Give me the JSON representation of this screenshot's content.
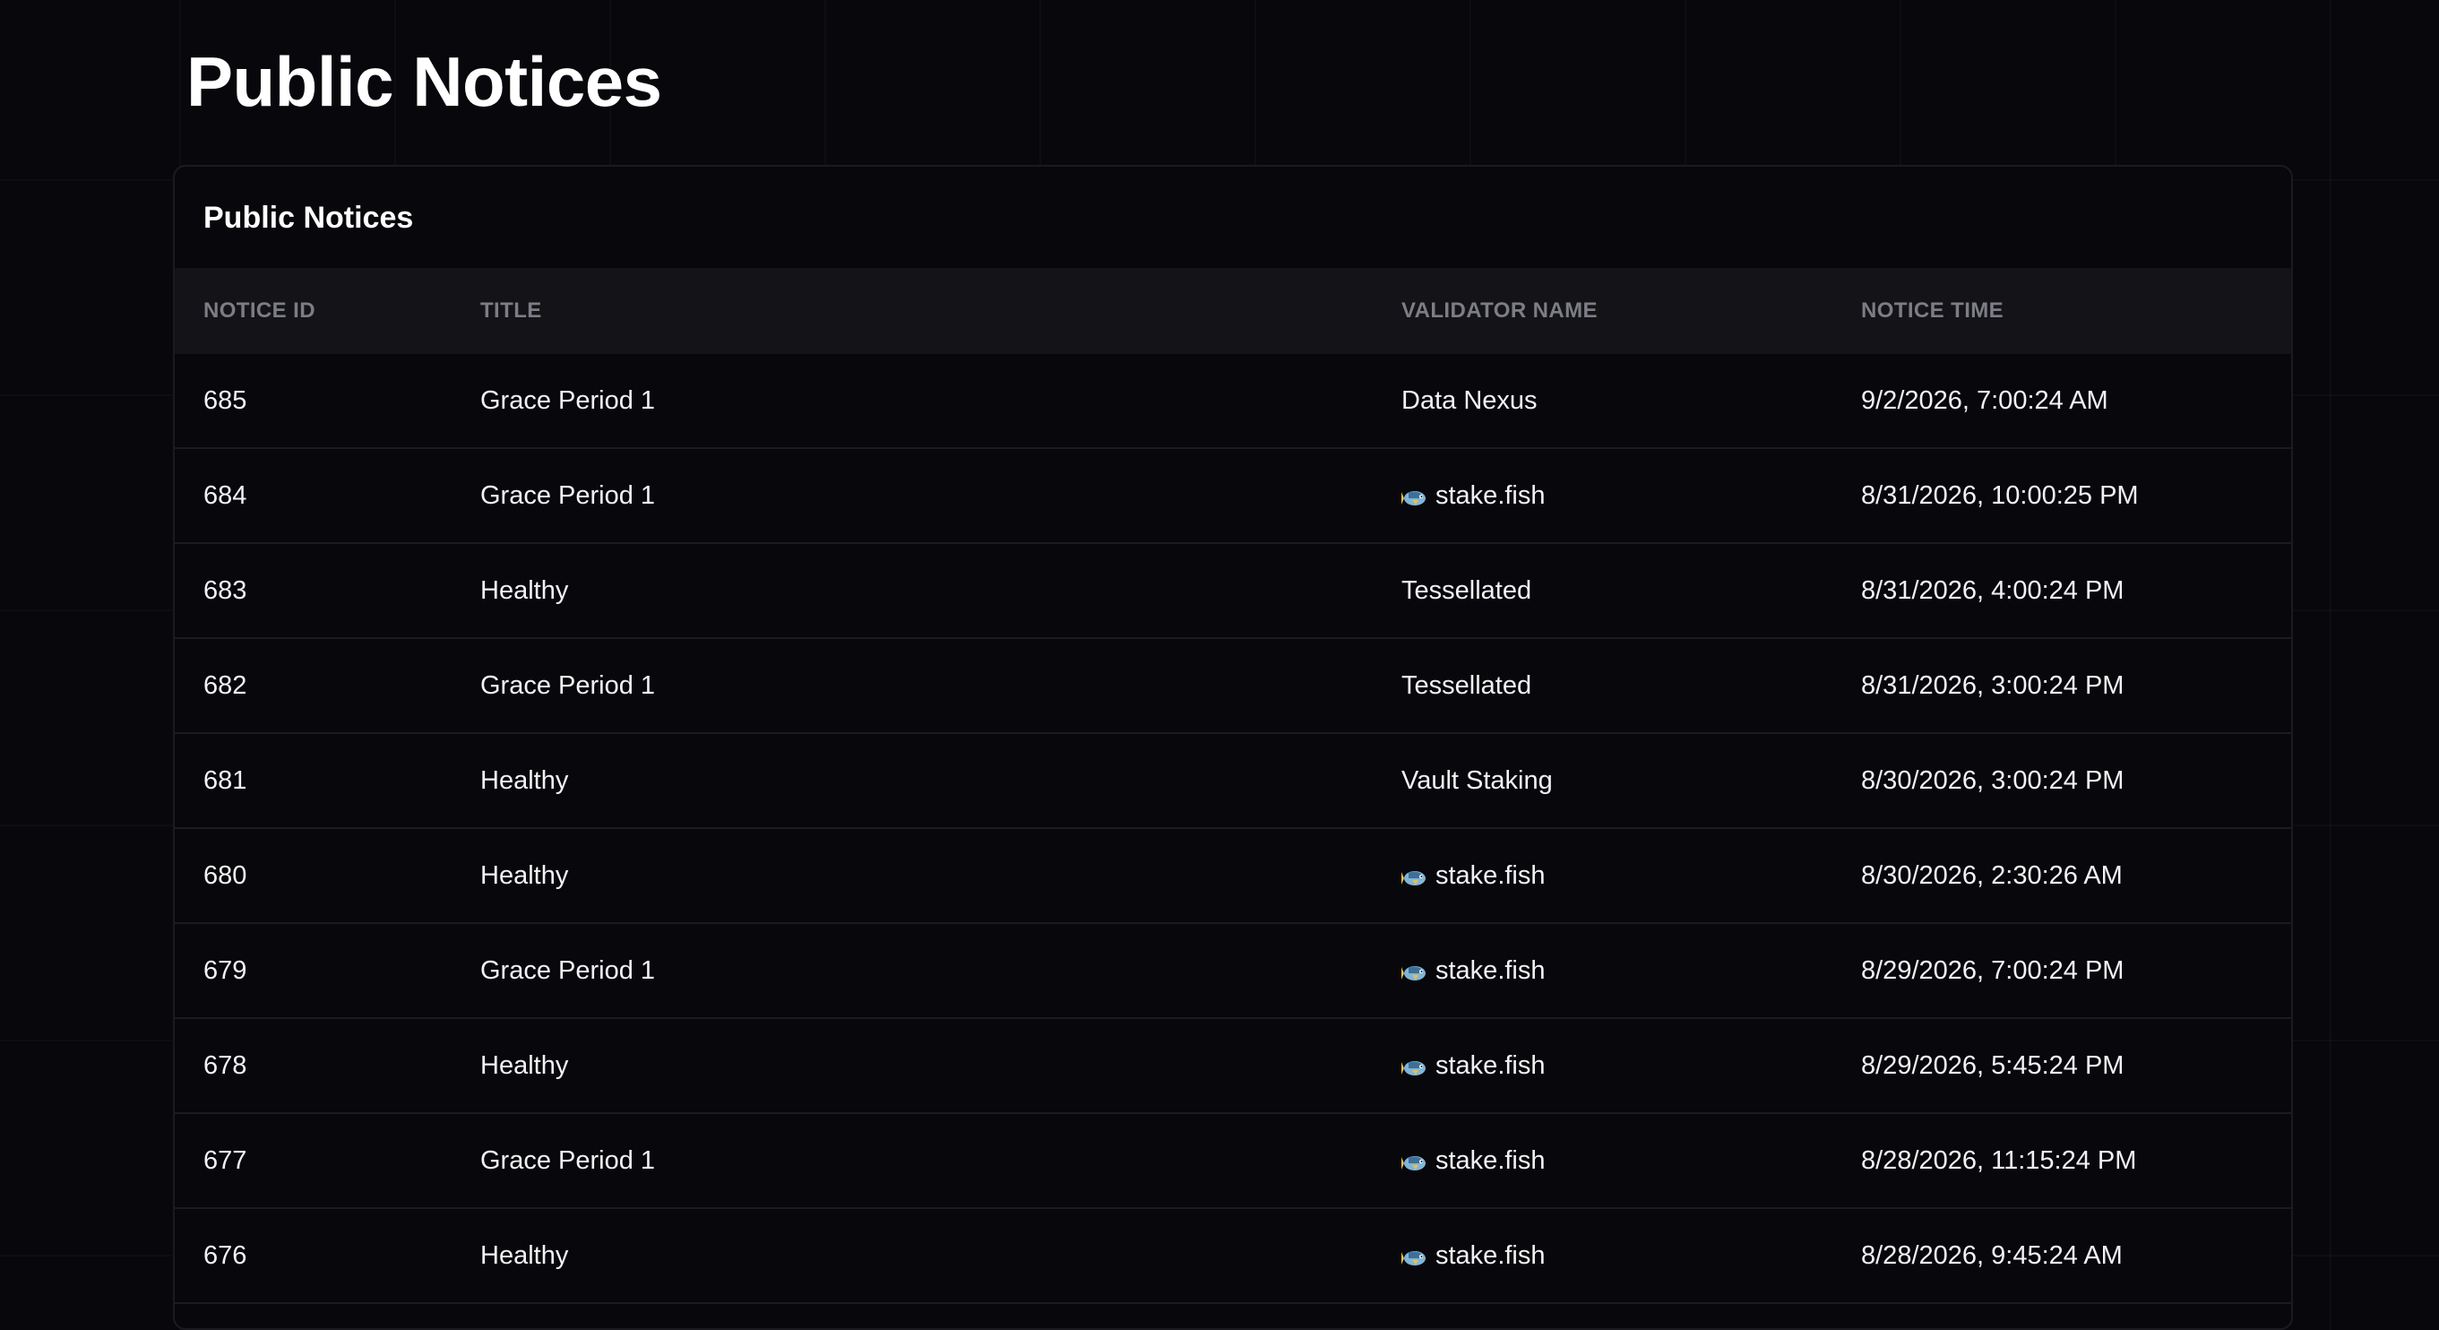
{
  "page": {
    "title": "Public Notices"
  },
  "card": {
    "title": "Public Notices"
  },
  "table": {
    "columns": [
      "NOTICE ID",
      "TITLE",
      "VALIDATOR NAME",
      "NOTICE TIME"
    ],
    "rows": [
      {
        "id": "685",
        "title": "Grace Period 1",
        "validator": "Data Nexus",
        "validator_icon": "",
        "time": "9/2/2026, 7:00:24 AM"
      },
      {
        "id": "684",
        "title": "Grace Period 1",
        "validator": "stake.fish",
        "validator_icon": "fish-icon",
        "time": "8/31/2026, 10:00:25 PM"
      },
      {
        "id": "683",
        "title": "Healthy",
        "validator": "Tessellated",
        "validator_icon": "",
        "time": "8/31/2026, 4:00:24 PM"
      },
      {
        "id": "682",
        "title": "Grace Period 1",
        "validator": "Tessellated",
        "validator_icon": "",
        "time": "8/31/2026, 3:00:24 PM"
      },
      {
        "id": "681",
        "title": "Healthy",
        "validator": "Vault Staking",
        "validator_icon": "",
        "time": "8/30/2026, 3:00:24 PM"
      },
      {
        "id": "680",
        "title": "Healthy",
        "validator": "stake.fish",
        "validator_icon": "fish-icon",
        "time": "8/30/2026, 2:30:26 AM"
      },
      {
        "id": "679",
        "title": "Grace Period 1",
        "validator": "stake.fish",
        "validator_icon": "fish-icon",
        "time": "8/29/2026, 7:00:24 PM"
      },
      {
        "id": "678",
        "title": "Healthy",
        "validator": "stake.fish",
        "validator_icon": "fish-icon",
        "time": "8/29/2026, 5:45:24 PM"
      },
      {
        "id": "677",
        "title": "Grace Period 1",
        "validator": "stake.fish",
        "validator_icon": "fish-icon",
        "time": "8/28/2026, 11:15:24 PM"
      },
      {
        "id": "676",
        "title": "Healthy",
        "validator": "stake.fish",
        "validator_icon": "fish-icon",
        "time": "8/28/2026, 9:45:24 AM"
      }
    ]
  },
  "colors": {
    "background": "#08080c",
    "header_row": "#131318",
    "border": "#1a1a20",
    "muted_text": "#7d7d86",
    "text": "#f2f2f4"
  }
}
